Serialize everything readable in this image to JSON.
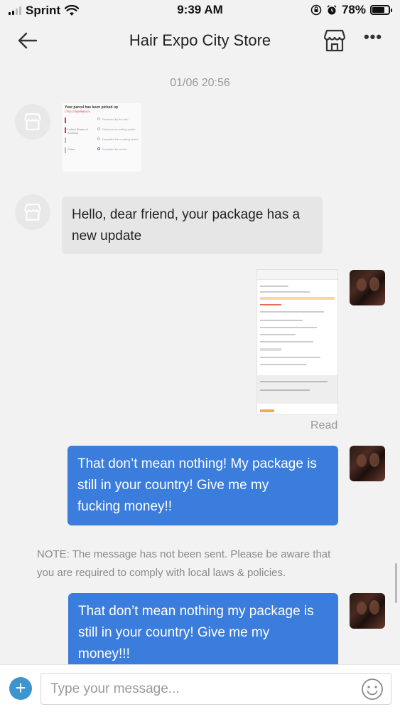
{
  "status_bar": {
    "carrier": "Sprint",
    "time": "9:39 AM",
    "battery_percent": "78%",
    "battery_level": 0.78,
    "icons": [
      "signal-icon",
      "wifi-icon",
      "orientation-lock-icon",
      "alarm-icon",
      "battery-icon"
    ]
  },
  "header": {
    "title": "Hair Expo City Store",
    "back_icon": "arrow-left-icon",
    "store_icon": "storefront-icon",
    "more_icon": "more-dots-icon",
    "more_glyph": "•••"
  },
  "conversation": {
    "date_separator": "01/06 20:56",
    "image_message_1": {
      "title": "Your parcel has been picked up",
      "subtitle": "LTN2173889980474",
      "rows": [
        {
          "left": "",
          "right": "Received by the hub"
        },
        {
          "left": "United States of America",
          "right": "Delivered at sorting center"
        },
        {
          "left": "",
          "right": "Departed from sorting center"
        },
        {
          "left": "China",
          "right": "Accepted by carrier"
        }
      ]
    },
    "store_message": {
      "line1": "Hello, dear friend, your package has a",
      "line2": "new update"
    },
    "read_label": "Read",
    "user_message_1": {
      "line1": "That don’t mean nothing! My package is",
      "line2": "still in your country! Give me my",
      "line3": "fucking money!!"
    },
    "note": {
      "line1": "NOTE: The message has not been sent. Please be aware that",
      "line2": "you are required to comply with local laws & policies."
    },
    "user_message_2": {
      "line1": "That don’t mean nothing my package is",
      "line2": "still in your country! Give me my",
      "line3": "money!!!"
    }
  },
  "input_bar": {
    "plus_glyph": "+",
    "placeholder": "Type your message...",
    "emoji_icon": "smiley-icon"
  },
  "colors": {
    "background": "#f2f2f2",
    "user_bubble": "#3b7ddd",
    "store_bubble": "#e6e6e6",
    "plus_button": "#3d95cf",
    "muted_text": "#999999"
  }
}
